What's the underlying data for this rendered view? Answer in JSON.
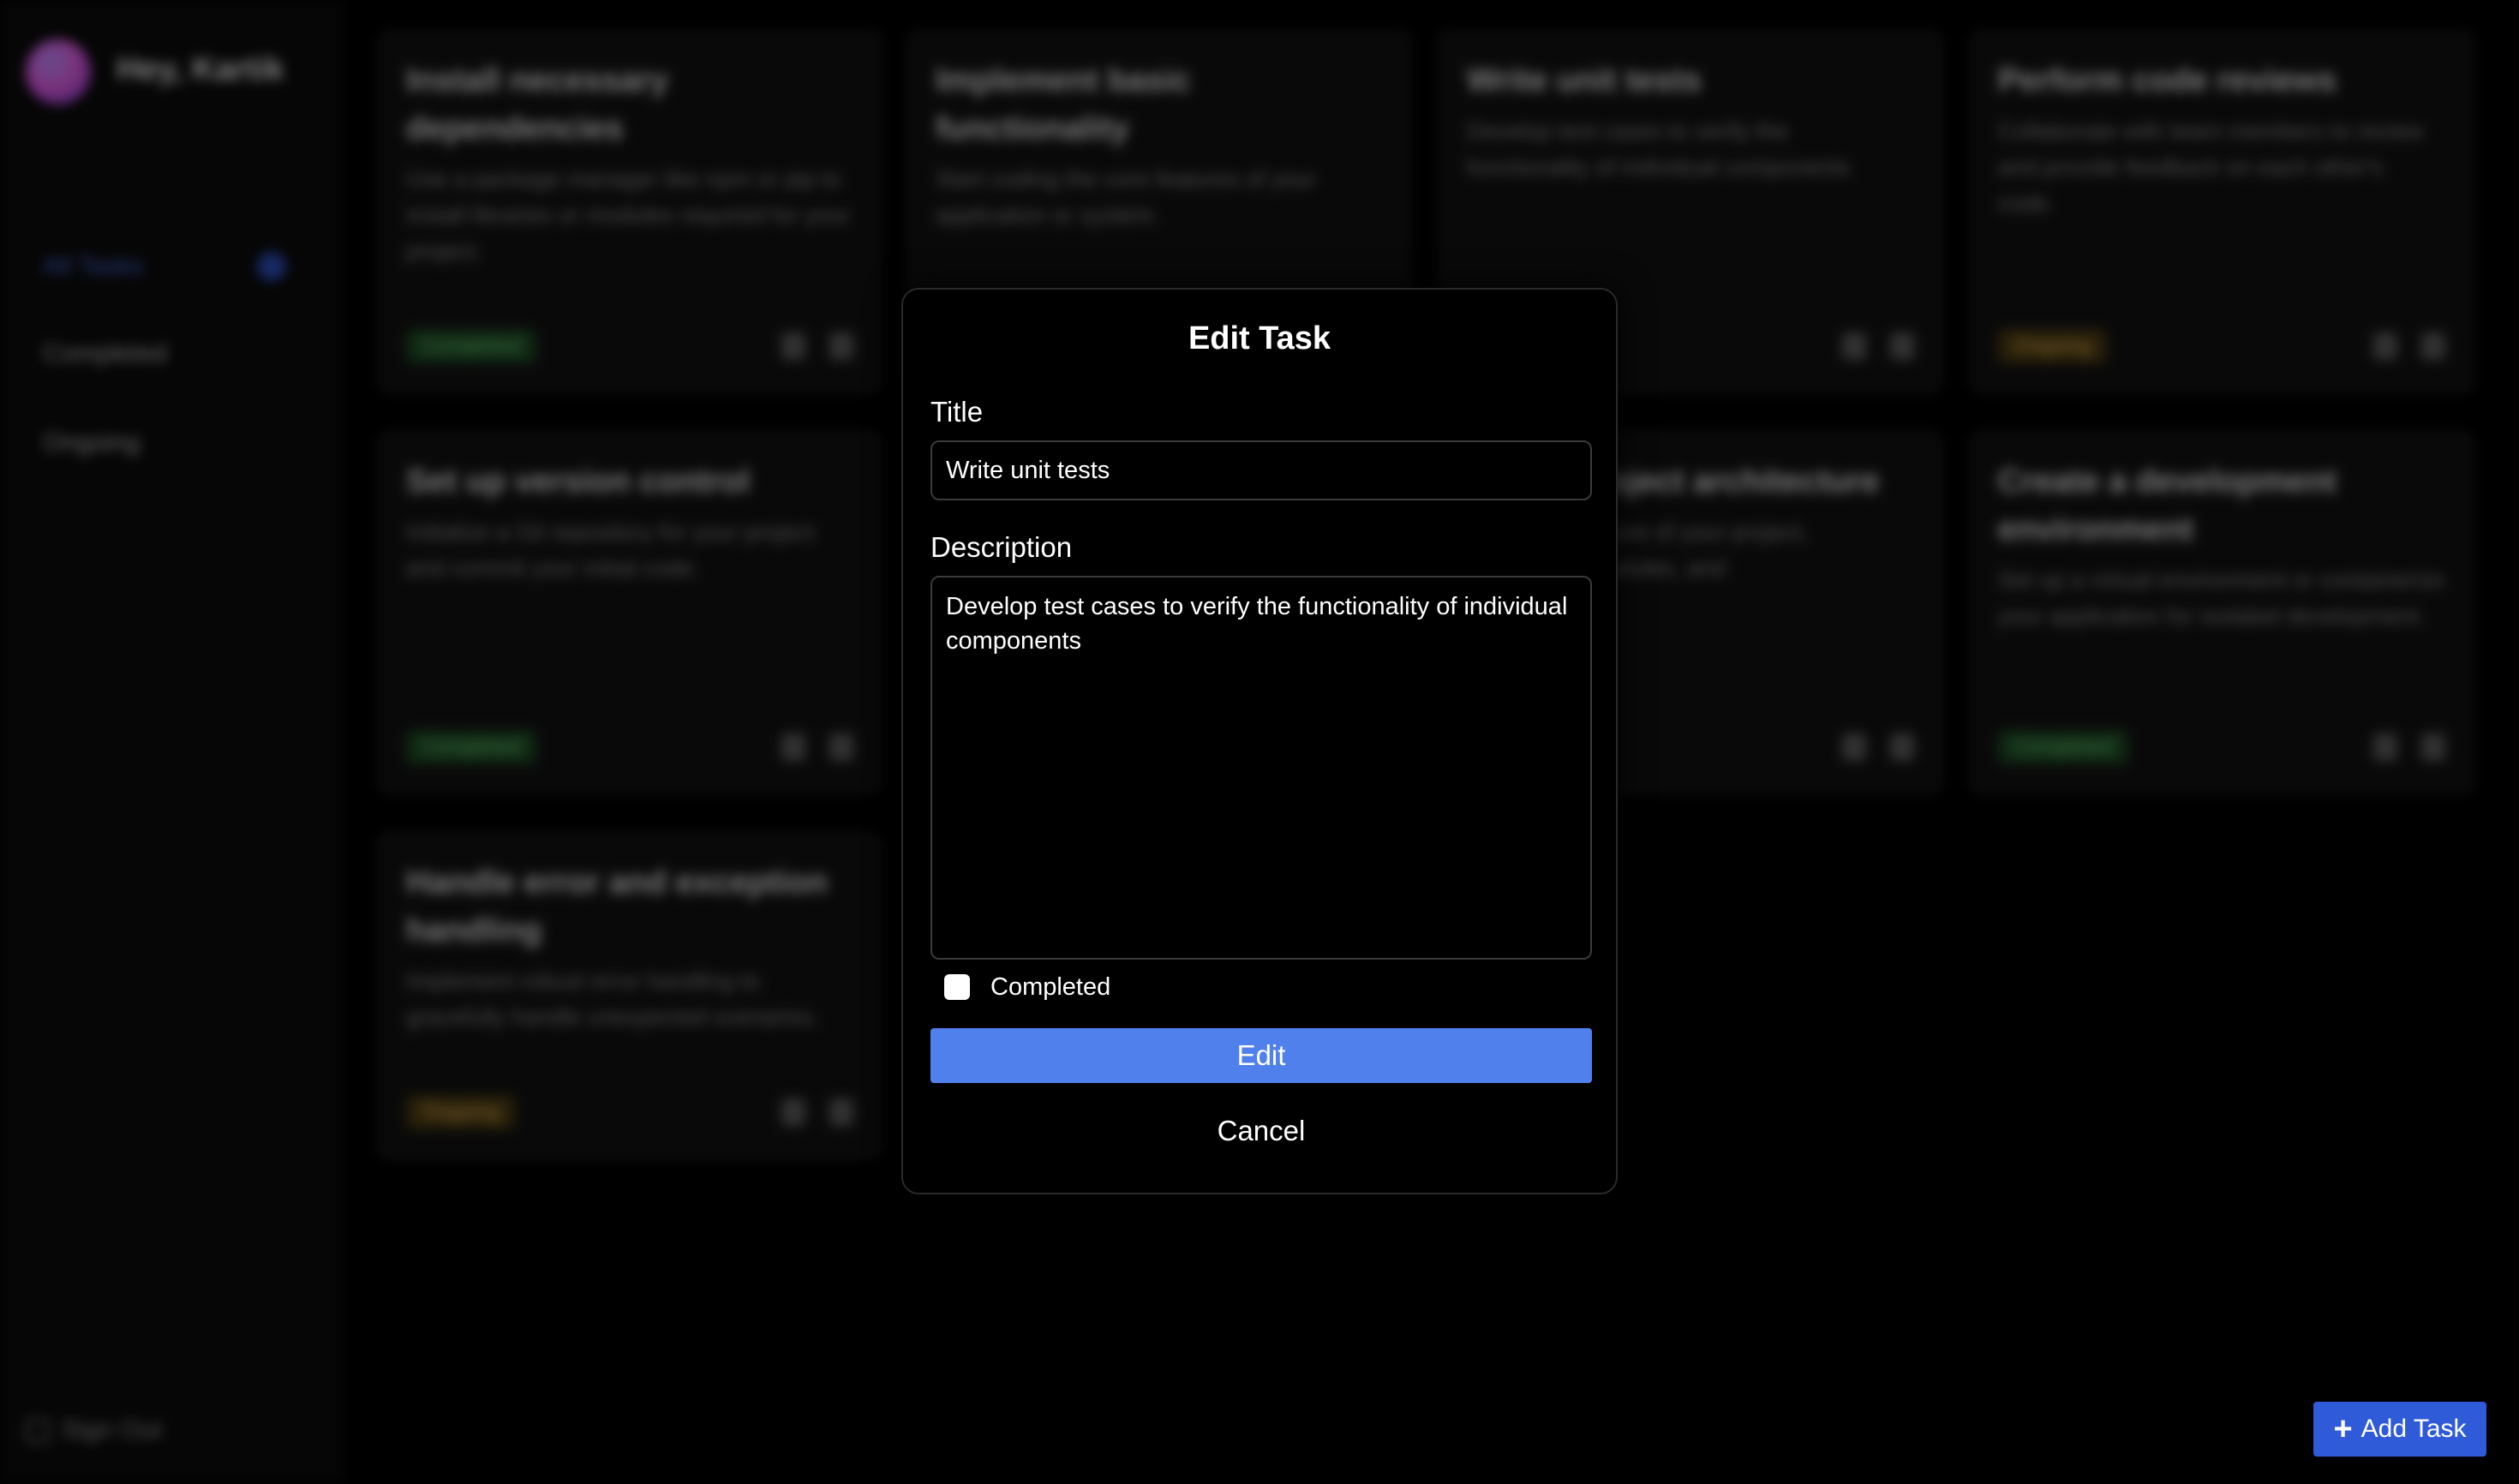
{
  "sidebar": {
    "greeting": "Hey, Kartik",
    "items": [
      {
        "label": "All Tasks"
      },
      {
        "label": "Completed"
      },
      {
        "label": "Ongoing"
      }
    ],
    "sign_out": "Sign Out"
  },
  "tasks": [
    {
      "title": "Install necessary dependencies",
      "description": "Use a package manager like npm or pip to install libraries or modules required for your project.",
      "status": "Completed"
    },
    {
      "title": "Implement basic functionality",
      "description": "Start coding the core features of your application or system.",
      "status": ""
    },
    {
      "title": "Write unit tests",
      "description": "Develop test cases to verify the functionality of individual components",
      "status": ""
    },
    {
      "title": "Perform code reviews",
      "description": "Collaborate with team members to review and provide feedback on each other's code.",
      "status": "Ongoing"
    },
    {
      "title": "Set up version control",
      "description": "Initialize a Git repository for your project and commit your initial code.",
      "status": "Completed"
    },
    {
      "title": "Define project architecture",
      "description": "Plan the structure of your project, directories, modules, and",
      "status": ""
    },
    {
      "title": "Create a development environment",
      "description": "Set up a virtual environment or containerize your application for isolated development.",
      "status": "Completed"
    },
    {
      "title": "Handle error and exception handling",
      "description": "Implement robust error handling to gracefully handle unexpected scenarios.",
      "status": "Ongoing"
    }
  ],
  "modal": {
    "title": "Edit Task",
    "title_label": "Title",
    "title_value": "Write unit tests",
    "description_label": "Description",
    "description_value": "Develop test cases to verify the functionality of individual components",
    "completed_label": "Completed",
    "completed_checked": false,
    "edit_label": "Edit",
    "cancel_label": "Cancel"
  },
  "add_task": {
    "label": "Add Task",
    "icon": "plus-icon"
  },
  "colors": {
    "accent": "#4f80ec",
    "add_button": "#2f5bd8",
    "completed": "#6fd27b",
    "ongoing": "#e6b84f"
  }
}
